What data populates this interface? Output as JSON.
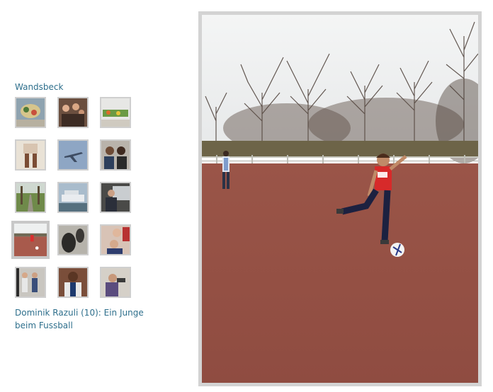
{
  "gallery": {
    "title": "Wandsbeck",
    "caption": "Dominik Razuli (10): Ein Junge beim Fussball",
    "selected_index": 9,
    "thumbnails": [
      {
        "name": "thumbnail-food-table"
      },
      {
        "name": "thumbnail-party-crowd"
      },
      {
        "name": "thumbnail-buffet"
      },
      {
        "name": "thumbnail-person-legs"
      },
      {
        "name": "thumbnail-airplane-sky"
      },
      {
        "name": "thumbnail-boys-portrait"
      },
      {
        "name": "thumbnail-tree-path"
      },
      {
        "name": "thumbnail-ship"
      },
      {
        "name": "thumbnail-man-car"
      },
      {
        "name": "thumbnail-boy-football"
      },
      {
        "name": "thumbnail-shadow-hand"
      },
      {
        "name": "thumbnail-children-group"
      },
      {
        "name": "thumbnail-people-posing"
      },
      {
        "name": "thumbnail-man-smiling"
      },
      {
        "name": "thumbnail-boy-camera"
      }
    ]
  },
  "colors": {
    "link": "#2e6f8c",
    "frame": "#d3d3d3",
    "field": "#a85a4c",
    "sky": "#f2f3f3"
  }
}
